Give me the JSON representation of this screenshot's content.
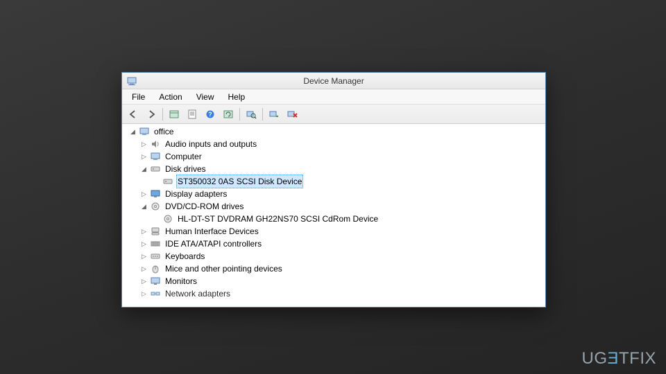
{
  "window": {
    "title": "Device Manager"
  },
  "menu": {
    "file": "File",
    "action": "Action",
    "view": "View",
    "help": "Help"
  },
  "toolbar": {
    "back": "back-icon",
    "forward": "forward-icon",
    "show_hidden": "show-hidden-icon",
    "properties": "properties-icon",
    "help": "help-icon",
    "refresh": "refresh-icon",
    "scan": "scan-hardware-icon",
    "update_driver": "update-driver-icon",
    "uninstall": "uninstall-icon"
  },
  "tree": {
    "root": "office",
    "audio": "Audio inputs and outputs",
    "computer": "Computer",
    "disk_drives": "Disk drives",
    "disk_device": "ST350032 0AS SCSI Disk Device",
    "display_adapters": "Display adapters",
    "dvd_drives": "DVD/CD-ROM drives",
    "dvd_device": "HL-DT-ST DVDRAM GH22NS70 SCSI CdRom Device",
    "hid": "Human Interface Devices",
    "ide": "IDE ATA/ATAPI controllers",
    "keyboards": "Keyboards",
    "mice": "Mice and other pointing devices",
    "monitors": "Monitors",
    "network": "Network adapters"
  },
  "watermark": "UGETFIX"
}
